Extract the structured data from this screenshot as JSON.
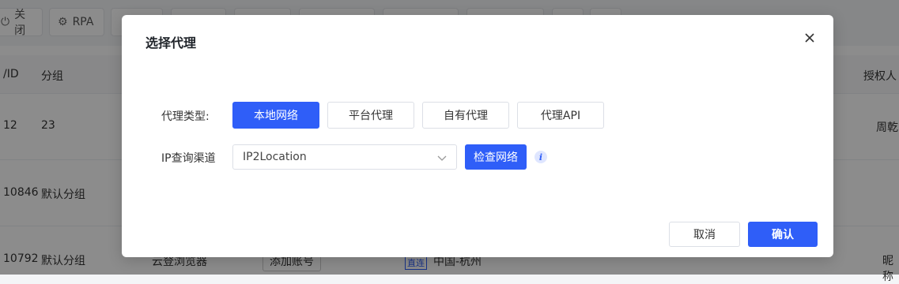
{
  "background": {
    "toolbar": [
      {
        "icon": "power-icon",
        "label": "关闭"
      },
      {
        "icon": "robot-icon",
        "label": "RPA"
      }
    ],
    "table": {
      "headers": {
        "id": "/ID",
        "group": "分组",
        "auth": "授权人"
      },
      "rows": [
        {
          "id": "12",
          "group": "23",
          "auth": "周乾"
        },
        {
          "id": "10846",
          "group": "默认分组",
          "auth": ""
        },
        {
          "id": "10792",
          "group": "默认分组",
          "auth": "昵称"
        }
      ],
      "partial": {
        "browser": "云登浏览器",
        "add_account": "添加账号",
        "tag": "直连",
        "location": "中国-杭州"
      }
    }
  },
  "dialog": {
    "title": "选择代理",
    "proxy_type_label": "代理类型:",
    "proxy_types": [
      "本地网络",
      "平台代理",
      "自有代理",
      "代理API"
    ],
    "selected_proxy_type": "本地网络",
    "ip_channel_label": "IP查询渠道",
    "ip_channel_value": "IP2Location",
    "check_network_label": "检查网络",
    "info_icon": "i",
    "cancel_label": "取消",
    "confirm_label": "确认"
  },
  "colors": {
    "primary": "#2f5ef8",
    "overlay": "rgba(0,0,0,0.45)"
  }
}
